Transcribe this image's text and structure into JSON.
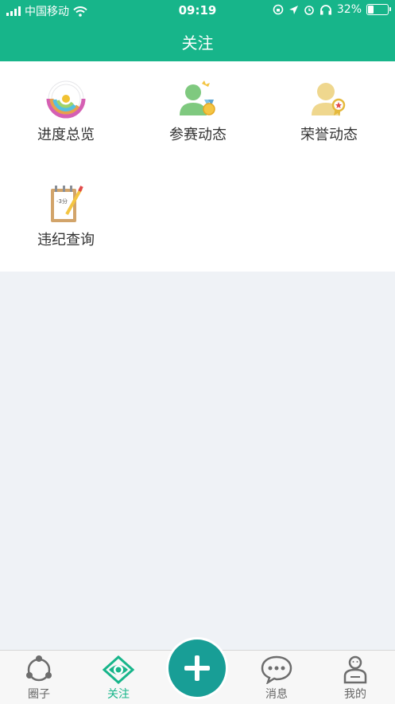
{
  "status": {
    "carrier": "中国移动",
    "time": "09:19",
    "battery": "32%",
    "battery_level": 0.32
  },
  "header": {
    "title": "关注"
  },
  "grid": {
    "items": [
      {
        "label": "进度总览",
        "icon": "progress-rings-icon"
      },
      {
        "label": "参赛动态",
        "icon": "user-medal-icon"
      },
      {
        "label": "荣誉动态",
        "icon": "user-award-icon"
      },
      {
        "label": "违纪查询",
        "icon": "clipboard-pencil-icon"
      }
    ]
  },
  "tabbar": {
    "items": [
      {
        "label": "圈子",
        "icon": "circle-people-icon"
      },
      {
        "label": "关注",
        "icon": "eye-icon",
        "active": true
      },
      {
        "label": "消息",
        "icon": "chat-bubble-icon"
      },
      {
        "label": "我的",
        "icon": "profile-icon"
      }
    ],
    "center_action": "add-icon"
  },
  "colors": {
    "brand": "#17b58a",
    "fab": "#189e96",
    "background": "#eff2f6"
  }
}
